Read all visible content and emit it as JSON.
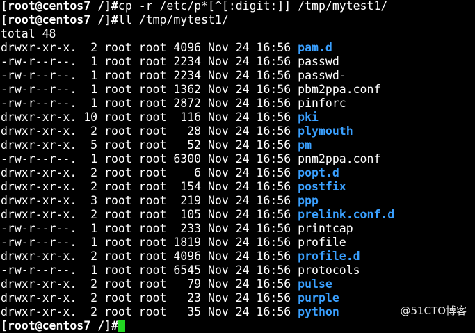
{
  "colors": {
    "background": "#000000",
    "text": "#ffffff",
    "directory": "#3aa0ff",
    "cursor": "#22d822"
  },
  "lines": [
    {
      "kind": "command",
      "prompt": "[root@centos7 /]#",
      "command": "cp -r /etc/p*[^[:digit:]] /tmp/mytest1/"
    },
    {
      "kind": "command",
      "prompt": "[root@centos7 /]#",
      "command": "ll /tmp/mytest1/"
    },
    {
      "kind": "text",
      "text": "total 48"
    },
    {
      "kind": "entry",
      "meta": "drwxr-xr-x.  2 root root 4096 Nov 24 16:56 ",
      "name": "pam.d",
      "type": "dir"
    },
    {
      "kind": "entry",
      "meta": "-rw-r--r--.  1 root root 2234 Nov 24 16:56 ",
      "name": "passwd",
      "type": "file"
    },
    {
      "kind": "entry",
      "meta": "-rw-r--r--.  1 root root 2234 Nov 24 16:56 ",
      "name": "passwd-",
      "type": "file"
    },
    {
      "kind": "entry",
      "meta": "-rw-r--r--.  1 root root 1362 Nov 24 16:56 ",
      "name": "pbm2ppa.conf",
      "type": "file"
    },
    {
      "kind": "entry",
      "meta": "-rw-r--r--.  1 root root 2872 Nov 24 16:56 ",
      "name": "pinforc",
      "type": "file"
    },
    {
      "kind": "entry",
      "meta": "drwxr-xr-x. 10 root root  116 Nov 24 16:56 ",
      "name": "pki",
      "type": "dir"
    },
    {
      "kind": "entry",
      "meta": "drwxr-xr-x.  2 root root   28 Nov 24 16:56 ",
      "name": "plymouth",
      "type": "dir"
    },
    {
      "kind": "entry",
      "meta": "drwxr-xr-x.  5 root root   52 Nov 24 16:56 ",
      "name": "pm",
      "type": "dir"
    },
    {
      "kind": "entry",
      "meta": "-rw-r--r--.  1 root root 6300 Nov 24 16:56 ",
      "name": "pnm2ppa.conf",
      "type": "file"
    },
    {
      "kind": "entry",
      "meta": "drwxr-xr-x.  2 root root    6 Nov 24 16:56 ",
      "name": "popt.d",
      "type": "dir"
    },
    {
      "kind": "entry",
      "meta": "drwxr-xr-x.  2 root root  154 Nov 24 16:56 ",
      "name": "postfix",
      "type": "dir"
    },
    {
      "kind": "entry",
      "meta": "drwxr-xr-x.  3 root root  219 Nov 24 16:56 ",
      "name": "ppp",
      "type": "dir"
    },
    {
      "kind": "entry",
      "meta": "drwxr-xr-x.  2 root root  105 Nov 24 16:56 ",
      "name": "prelink.conf.d",
      "type": "dir"
    },
    {
      "kind": "entry",
      "meta": "-rw-r--r--.  1 root root  233 Nov 24 16:56 ",
      "name": "printcap",
      "type": "file"
    },
    {
      "kind": "entry",
      "meta": "-rw-r--r--.  1 root root 1819 Nov 24 16:56 ",
      "name": "profile",
      "type": "file"
    },
    {
      "kind": "entry",
      "meta": "drwxr-xr-x.  2 root root 4096 Nov 24 16:56 ",
      "name": "profile.d",
      "type": "dir"
    },
    {
      "kind": "entry",
      "meta": "-rw-r--r--.  1 root root 6545 Nov 24 16:56 ",
      "name": "protocols",
      "type": "file"
    },
    {
      "kind": "entry",
      "meta": "drwxr-xr-x.  2 root root   79 Nov 24 16:56 ",
      "name": "pulse",
      "type": "dir"
    },
    {
      "kind": "entry",
      "meta": "drwxr-xr-x.  2 root root   23 Nov 24 16:56 ",
      "name": "purple",
      "type": "dir"
    },
    {
      "kind": "entry",
      "meta": "drwxr-xr-x.  2 root root   35 Nov 24 16:56 ",
      "name": "python",
      "type": "dir"
    },
    {
      "kind": "command",
      "prompt": "[root@centos7 /]#",
      "command": "",
      "cursor": true
    }
  ],
  "watermark": "@51CTO博客"
}
